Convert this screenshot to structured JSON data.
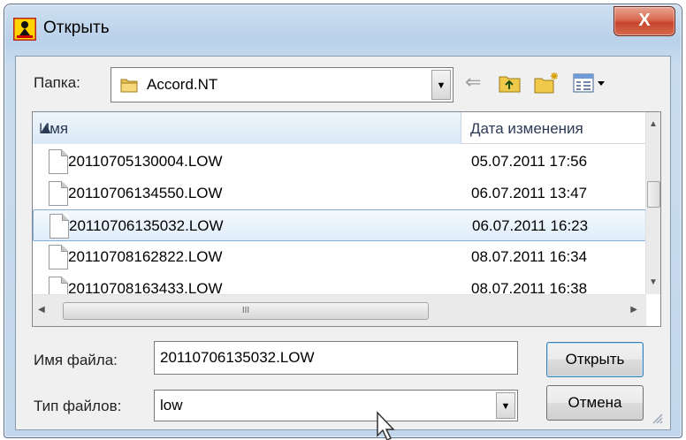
{
  "window": {
    "title": "Открыть",
    "close_glyph": "X"
  },
  "folder": {
    "label": "Папка:",
    "current": "Accord.NT",
    "icon": "folder-icon"
  },
  "toolbar": {
    "back_icon": "back-arrow-icon",
    "up_icon": "up-one-level-icon",
    "new_folder_icon": "new-folder-icon",
    "view_icon": "view-menu-icon",
    "back_glyph": "⇐"
  },
  "list": {
    "columns": [
      "Имя",
      "Дата изменения"
    ],
    "rows": [
      {
        "name": "20110705130004.LOW",
        "date": "05.07.2011 17:56",
        "selected": false
      },
      {
        "name": "20110706134550.LOW",
        "date": "06.07.2011 13:47",
        "selected": false
      },
      {
        "name": "20110706135032.LOW",
        "date": "06.07.2011 16:23",
        "selected": true
      },
      {
        "name": "20110708162822.LOW",
        "date": "08.07.2011 16:34",
        "selected": false
      },
      {
        "name": "20110708163433.LOW",
        "date": "08.07.2011 16:38",
        "selected": false
      }
    ],
    "hscroll_thumb": "III"
  },
  "filename": {
    "label": "Имя файла:",
    "value": "20110706135032.LOW"
  },
  "filetype": {
    "label": "Тип файлов:",
    "value": "low"
  },
  "buttons": {
    "open": "Открыть",
    "cancel": "Отмена"
  },
  "colors": {
    "selection_border": "#84acdd",
    "close_button": "#c7452b",
    "title_gradient": "#b9d1ea"
  }
}
